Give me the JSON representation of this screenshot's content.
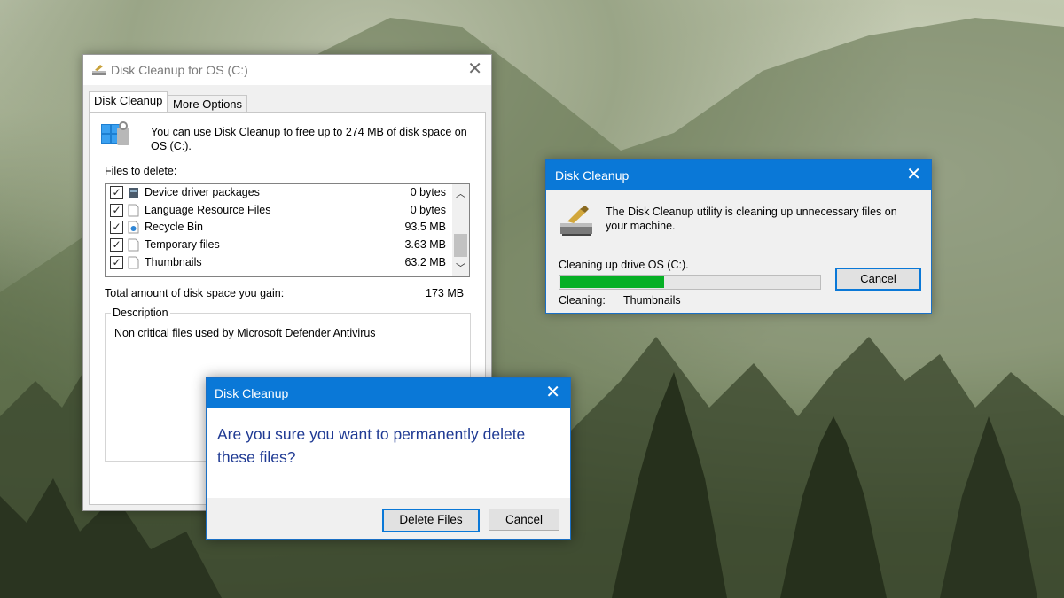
{
  "main_window": {
    "title": "Disk Cleanup for OS (C:)",
    "close_glyph": "✕",
    "tabs": [
      {
        "label": "Disk Cleanup",
        "active": true
      },
      {
        "label": "More Options",
        "active": false
      }
    ],
    "intro_text": "You can use Disk Cleanup to free up to 274 MB of disk space on OS (C:).",
    "files_label": "Files to delete:",
    "files": [
      {
        "name": "Device driver packages",
        "size": "0 bytes",
        "checked": true,
        "icon": "driver-package-icon"
      },
      {
        "name": "Language Resource Files",
        "size": "0 bytes",
        "checked": true,
        "icon": "file-icon"
      },
      {
        "name": "Recycle Bin",
        "size": "93.5 MB",
        "checked": true,
        "icon": "recycle-bin-icon"
      },
      {
        "name": "Temporary files",
        "size": "3.63 MB",
        "checked": true,
        "icon": "file-icon"
      },
      {
        "name": "Thumbnails",
        "size": "63.2 MB",
        "checked": true,
        "icon": "file-icon"
      }
    ],
    "total_label": "Total amount of disk space you gain:",
    "total_value": "173 MB",
    "description_label": "Description",
    "description_text": "Non critical files used by Microsoft Defender Antivirus"
  },
  "progress_dialog": {
    "title": "Disk Cleanup",
    "close_glyph": "✕",
    "message": "The Disk Cleanup utility is cleaning up unnecessary files on your machine.",
    "drive_label": "Cleaning up drive OS (C:).",
    "progress_fraction": 0.4,
    "cancel_label": "Cancel",
    "cleaning_label": "Cleaning:",
    "cleaning_value": "Thumbnails"
  },
  "confirm_dialog": {
    "title": "Disk Cleanup",
    "close_glyph": "✕",
    "message": "Are you sure you want to permanently delete these files?",
    "delete_label": "Delete Files",
    "cancel_label": "Cancel"
  },
  "colors": {
    "title_blue": "#0a78d7",
    "progress_green": "#06b025",
    "confirm_text": "#1f3a93"
  }
}
